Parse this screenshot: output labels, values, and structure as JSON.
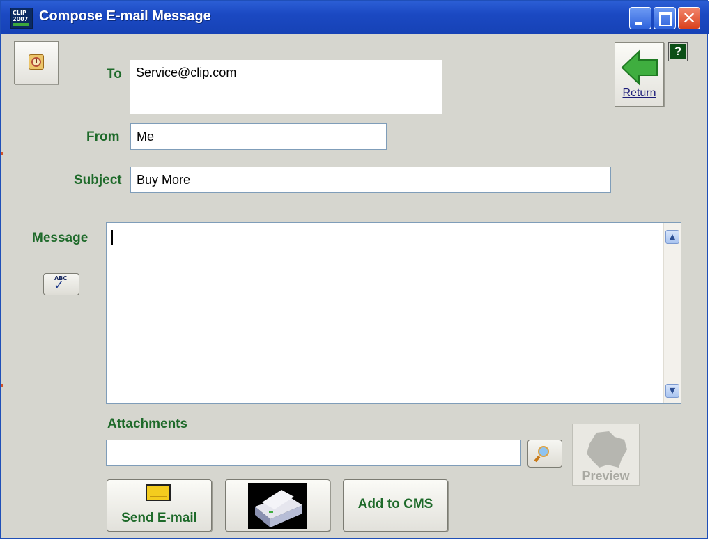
{
  "window": {
    "title": "Compose E-mail Message",
    "logo_line1": "CLIP",
    "logo_line2": "2007"
  },
  "labels": {
    "to": "To",
    "from": "From",
    "subject": "Subject",
    "message": "Message",
    "attachments": "Attachments"
  },
  "fields": {
    "to": "Service@clip.com",
    "from": "Me",
    "subject": "Buy More",
    "message": "",
    "attachments": ""
  },
  "buttons": {
    "return": "Return",
    "help": "?",
    "preview": "Preview",
    "send_email": "Send E-mail",
    "send_email_accel": "S",
    "send_email_rest": "end E-mail",
    "add_to_cms": "Add to CMS",
    "spell_icon_text": "ABC"
  },
  "icons": {
    "clock": "clock-icon",
    "spell": "spellcheck-icon",
    "search": "search-icon",
    "envelope": "envelope-icon",
    "printer": "printer-icon",
    "preview": "map-preview-icon",
    "return": "return-arrow-icon",
    "help": "help-icon"
  },
  "colors": {
    "label_green": "#1e6a2a",
    "titlebar_blue": "#1b49c2",
    "window_bg": "#d6d6cf"
  }
}
